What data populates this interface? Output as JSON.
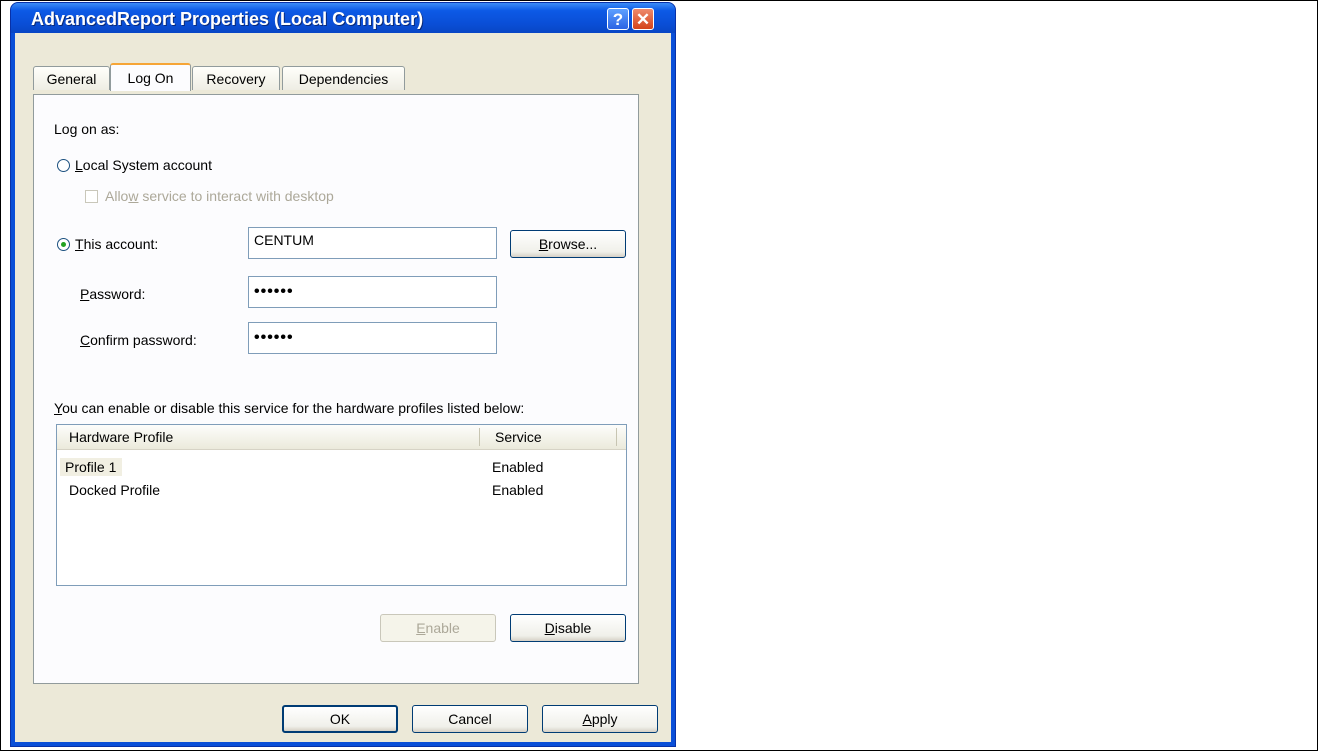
{
  "window": {
    "title": "AdvancedReport Properties (Local Computer)",
    "help_glyph": "?",
    "close_glyph": "✕"
  },
  "tabs": [
    {
      "label": "General"
    },
    {
      "label": "Log On"
    },
    {
      "label": "Recovery"
    },
    {
      "label": "Dependencies"
    }
  ],
  "logon": {
    "log_on_as": "Log on as:",
    "local_system_first": "L",
    "local_system_rest": "ocal System account",
    "allow_pre": "Allo",
    "allow_u": "w",
    "allow_rest": " service to interact with desktop",
    "this_account_first": "T",
    "this_account_rest": "his account:",
    "account_value": "CENTUM",
    "browse_pre": "B",
    "browse_rest": "rowse...",
    "password_first": "P",
    "password_rest": "assword:",
    "password_value": "••••••",
    "confirm_first": "C",
    "confirm_rest": "onfirm password:",
    "confirm_value": "••••••",
    "selected_option": "This account",
    "allow_interact_checked": false
  },
  "profiles": {
    "description_first": "Y",
    "description_rest": "ou can enable or disable this service for the hardware profiles listed below:",
    "columns": [
      "Hardware Profile",
      "Service"
    ],
    "rows": [
      {
        "profile": "Profile 1",
        "service": "Enabled"
      },
      {
        "profile": "Docked Profile",
        "service": "Enabled"
      }
    ],
    "enable_first": "E",
    "enable_rest": "nable",
    "disable_first": "D",
    "disable_rest": "isable"
  },
  "footer": {
    "ok": "OK",
    "cancel": "Cancel",
    "apply_first": "A",
    "apply_rest": "pply"
  }
}
